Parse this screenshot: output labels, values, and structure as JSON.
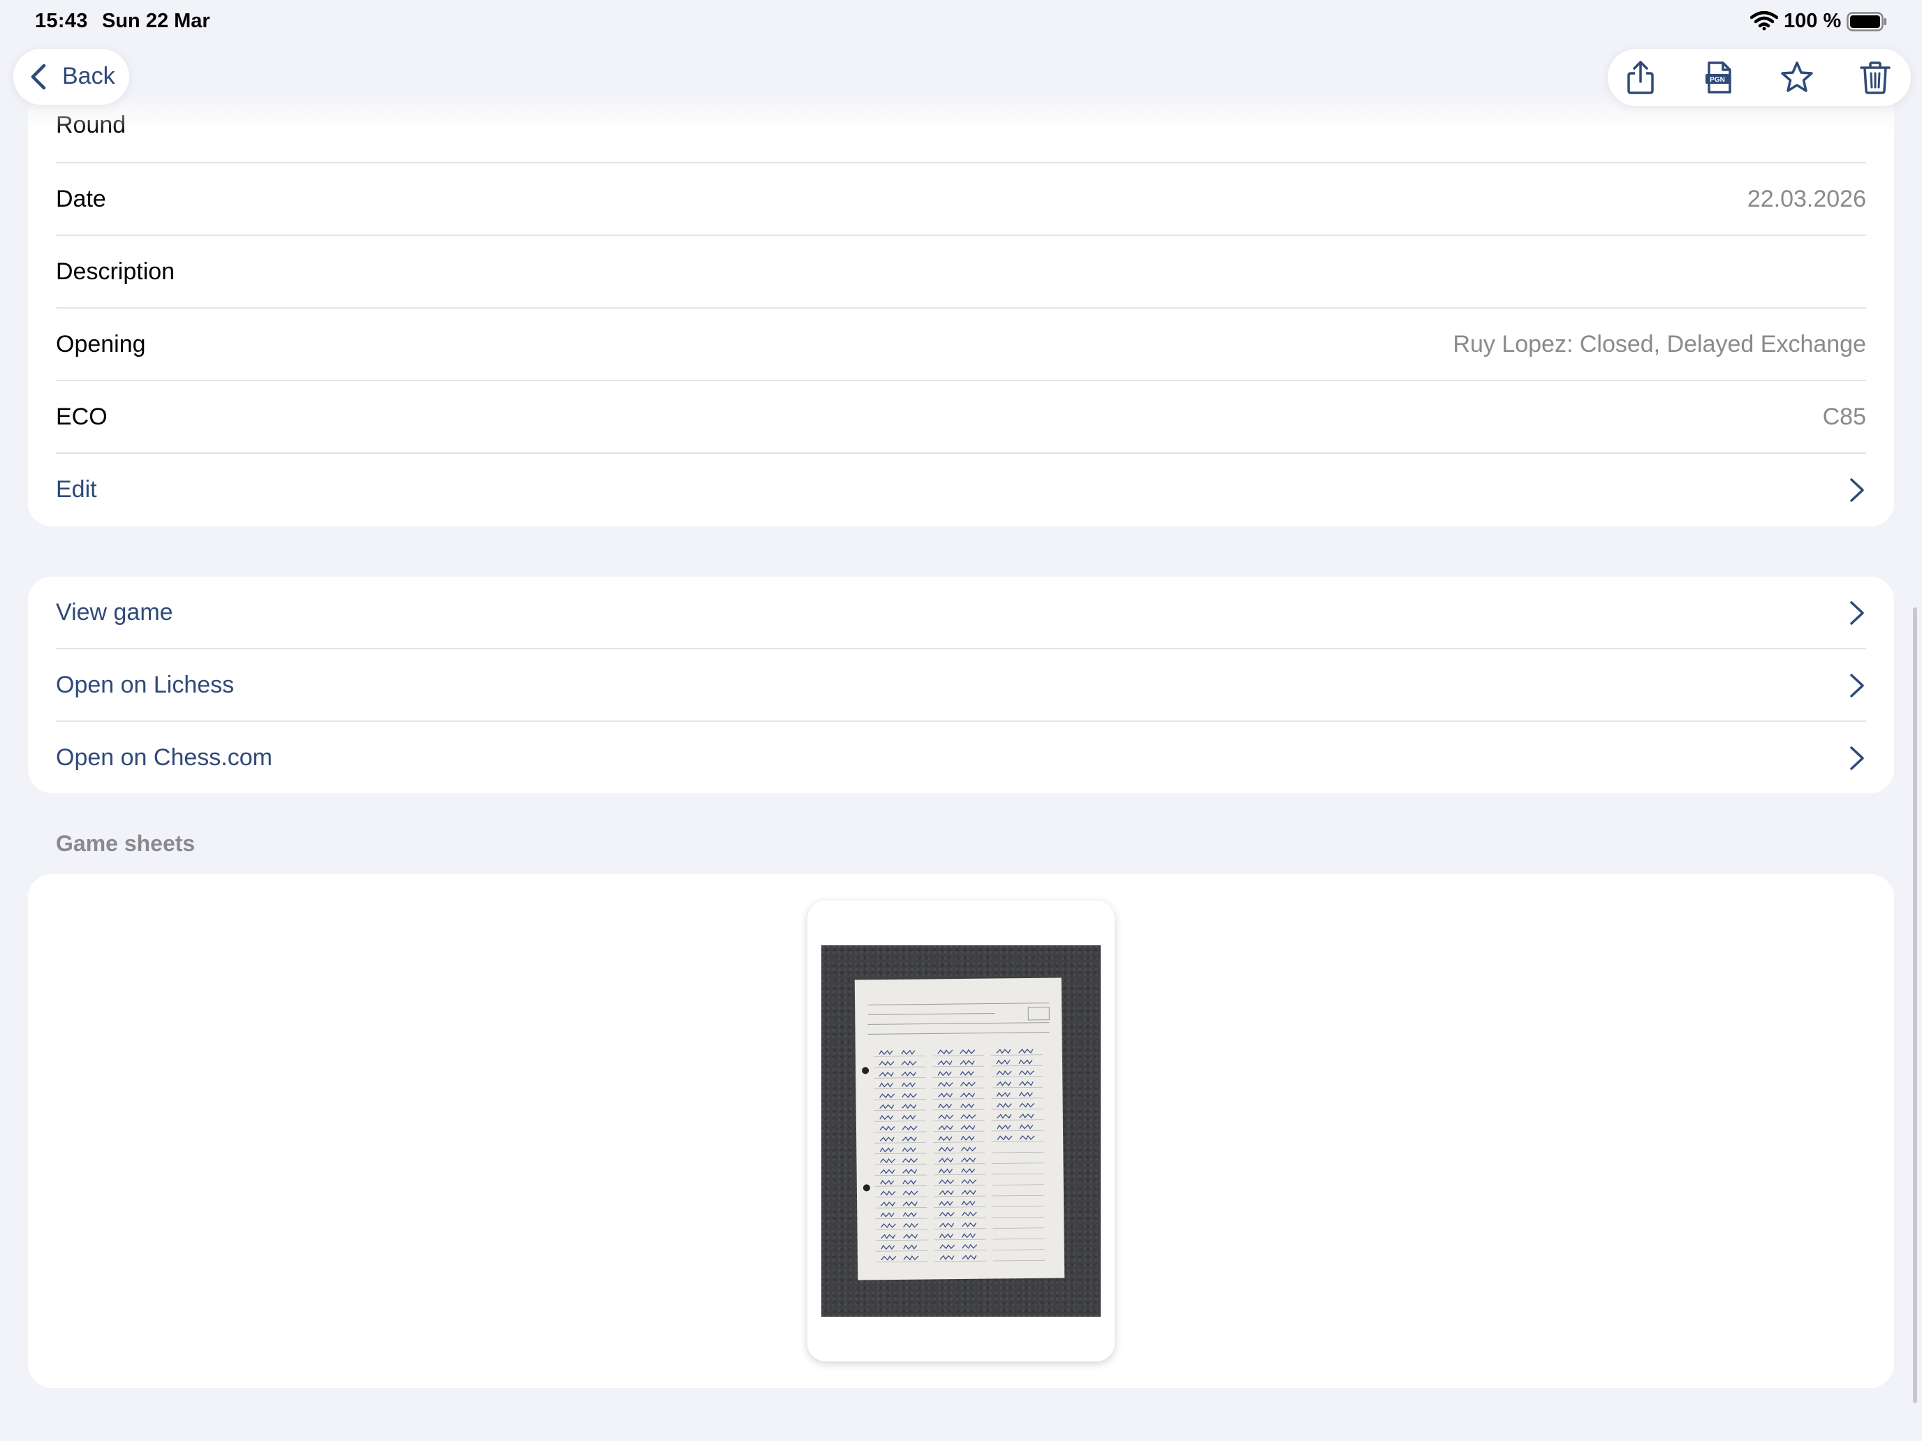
{
  "status_bar": {
    "time": "15:43",
    "date": "Sun 22 Mar",
    "battery_pct": "100 %"
  },
  "nav": {
    "back_label": "Back",
    "toolbar_icons": [
      "share-icon",
      "pgn-file-icon",
      "star-icon",
      "trash-icon"
    ],
    "pgn_badge": "PGN"
  },
  "details": {
    "partial_row_label": "Round",
    "rows": [
      {
        "label": "Date",
        "value": "22.03.2026"
      },
      {
        "label": "Description",
        "value": ""
      },
      {
        "label": "Opening",
        "value": "Ruy Lopez: Closed, Delayed Exchange"
      },
      {
        "label": "ECO",
        "value": "C85"
      }
    ],
    "edit_label": "Edit"
  },
  "actions": [
    {
      "label": "View game"
    },
    {
      "label": "Open on Lichess"
    },
    {
      "label": "Open on Chess.com"
    }
  ],
  "game_sheets": {
    "title": "Game sheets"
  },
  "colors": {
    "accent": "#2f4a78",
    "secondary_text": "#8a8a8e",
    "background": "#f2f3f8"
  }
}
